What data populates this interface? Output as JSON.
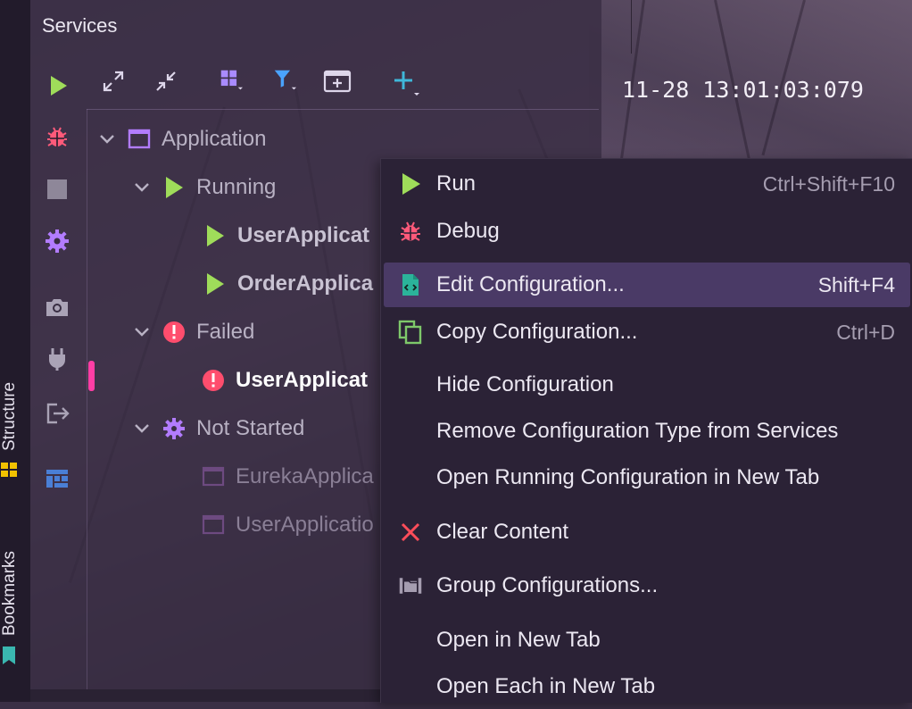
{
  "panel": {
    "title": "Services"
  },
  "timestamp": "11-28 13:01:03:079",
  "vertical_tabs": {
    "structure": "Structure",
    "bookmarks": "Bookmarks"
  },
  "toolbar": [
    "play-icon",
    "expand-all-icon",
    "collapse-all-icon",
    "group-icon",
    "filter-icon",
    "new-tab-icon",
    "add-icon"
  ],
  "side_actions": [
    "debug-icon",
    "stop-icon",
    "settings-icon",
    "camera-icon",
    "plug-icon",
    "exit-icon",
    "dashboard-icon"
  ],
  "tree": {
    "application": "Application",
    "running": "Running",
    "running_items": [
      "UserApplicat",
      "OrderApplica"
    ],
    "failed": "Failed",
    "failed_items": [
      "UserApplicat"
    ],
    "not_started": "Not Started",
    "not_started_items": [
      "EurekaApplica",
      "UserApplicatio"
    ]
  },
  "context_menu": {
    "items": [
      {
        "label": "Run",
        "shortcut": "Ctrl+Shift+F10",
        "icon": "run-icon"
      },
      {
        "label": "Debug",
        "shortcut": "",
        "icon": "debug-icon"
      },
      {
        "label": "Edit Configuration...",
        "shortcut": "Shift+F4",
        "icon": "edit-config-icon",
        "selected": true
      },
      {
        "label": "Copy Configuration...",
        "shortcut": "Ctrl+D",
        "icon": "copy-icon"
      },
      {
        "label": "Hide Configuration",
        "shortcut": ""
      },
      {
        "label": "Remove Configuration Type from Services",
        "shortcut": ""
      },
      {
        "label": "Open Running Configuration in New Tab",
        "shortcut": ""
      },
      {
        "label": "Clear Content",
        "shortcut": "",
        "icon": "clear-icon"
      },
      {
        "label": "Group Configurations...",
        "shortcut": "",
        "icon": "group-config-icon"
      },
      {
        "label": "Open in New Tab",
        "shortcut": ""
      },
      {
        "label": "Open Each in New Tab",
        "shortcut": ""
      }
    ]
  },
  "colors": {
    "run": "#9fdc5a",
    "debug": "#ff5a7a",
    "failed": "#ff4d6d",
    "accent_purple": "#b27cff",
    "selection": "#4a3a66",
    "clear": "#ff4d5a"
  }
}
